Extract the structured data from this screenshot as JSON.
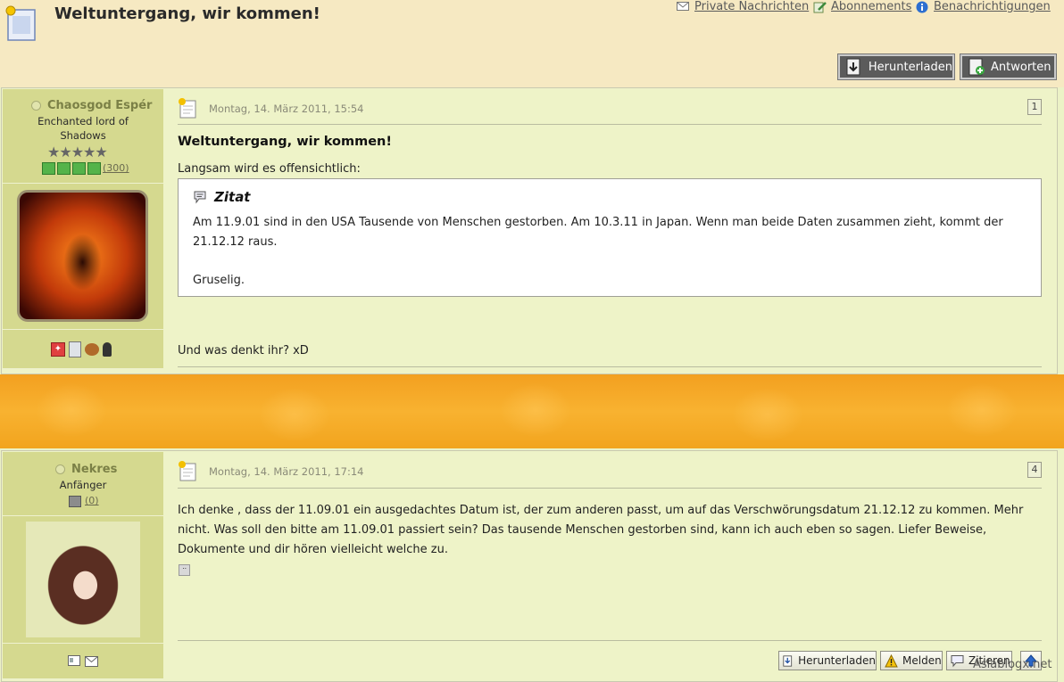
{
  "thread": {
    "title": "Weltuntergang, wir kommen!"
  },
  "top_links": [
    {
      "label": "Private Nachrichten",
      "icon": "envelope-icon"
    },
    {
      "label": "Abonnements",
      "icon": "pencil-note-icon"
    },
    {
      "label": "Benachrichtigungen",
      "icon": "info-icon"
    }
  ],
  "header_buttons": {
    "download": {
      "label": "Herunterladen",
      "icon": "download-icon"
    },
    "reply": {
      "label": "Antworten",
      "icon": "add-reply-icon"
    }
  },
  "posts": [
    {
      "author": {
        "name": "Chaosgod Espér",
        "rank": "Enchanted lord of Shadows",
        "stars": 5,
        "activity_count": "(300)"
      },
      "date": "Montag, 14. März 2011, 15:54",
      "number": "1",
      "title": "Weltuntergang, wir kommen!",
      "intro": "Langsam wird es offensichtlich:",
      "quote": {
        "label": "Zitat",
        "line1": "Am 11.9.01 sind in den USA Tausende von Menschen gestorben. Am 10.3.11 in Japan. Wenn man beide Daten zusammen zieht, kommt der 21.12.12 raus.",
        "line2": "Gruselig."
      },
      "closing": "Und was denkt ihr? xD"
    },
    {
      "author": {
        "name": "Nekres",
        "rank": "Anfänger",
        "activity_count": "(0)"
      },
      "date": "Montag, 14. März 2011, 17:14",
      "number": "4",
      "text": "Ich denke , dass der 11.09.01 ein ausgedachtes Datum ist, der zum anderen passt, um auf das Verschwörungsdatum 21.12.12 zu kommen. Mehr nicht. Was soll den bitte am 11.09.01 passiert sein? Das tausende Menschen gestorben sind, kann ich auch eben so sagen. Liefer Beweise, Dokumente und dir hören vielleicht welche zu.",
      "footer_buttons": {
        "download": "Herunterladen",
        "report": "Melden",
        "quote": "Zitieren"
      }
    }
  ],
  "watermark": "Asiablogx.net",
  "colors": {
    "header_bg": "#f6e9c2",
    "post_bg": "#eef3c8",
    "sidebar_bg": "#d5d98f",
    "username": "#7b8046",
    "banner_orange": "#f5a623",
    "button_dark": "#5b5b5b"
  }
}
